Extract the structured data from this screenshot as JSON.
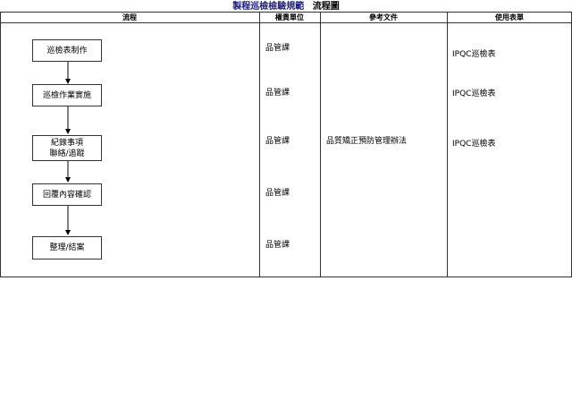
{
  "title": {
    "main": "製程巡檢檢驗規範",
    "sub": "流程圖"
  },
  "headers": {
    "flow": "流程",
    "unit": "權責單位",
    "reference": "參考文件",
    "forms": "使用表單"
  },
  "steps": [
    {
      "lines": [
        "巡檢表制作"
      ]
    },
    {
      "lines": [
        "巡檢作業實施"
      ]
    },
    {
      "lines": [
        "紀錄事項",
        "聯絡/追蹤"
      ]
    },
    {
      "lines": [
        "回覆內容確認"
      ]
    },
    {
      "lines": [
        "整理/結案"
      ]
    }
  ],
  "units": [
    "品管課",
    "品管課",
    "品管課",
    "品管課",
    "品管課"
  ],
  "reference_doc": "品質矯正預防管理辦法",
  "forms": [
    "IPQC巡檢表",
    "IPQC巡檢表",
    "IPQC巡檢表"
  ]
}
